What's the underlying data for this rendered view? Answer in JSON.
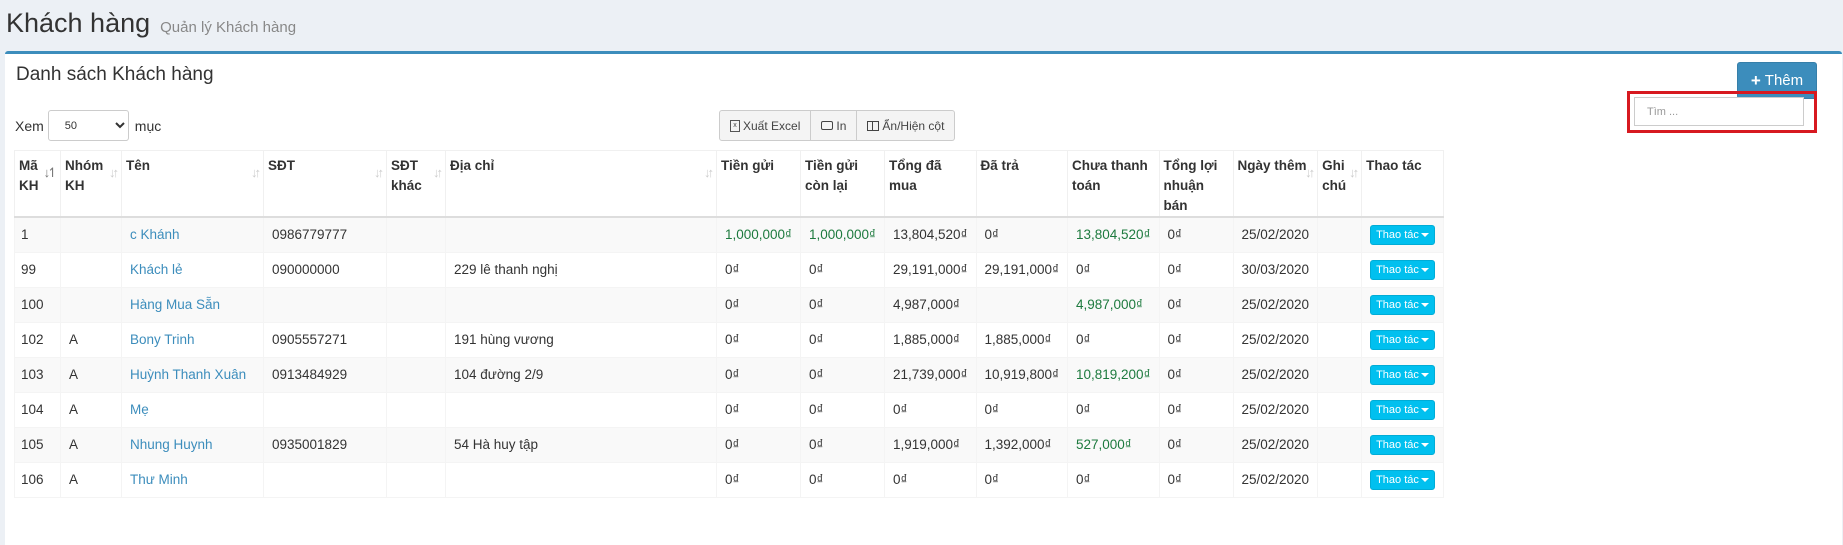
{
  "header": {
    "title": "Khách hàng",
    "subtitle": "Quản lý Khách hàng"
  },
  "box": {
    "title": "Danh sách Khách hàng",
    "add_label": "Thêm"
  },
  "length_menu": {
    "prefix": "Xem",
    "selected": "50",
    "suffix": "mục"
  },
  "toolbar": {
    "excel_label": "Xuất Excel",
    "print_label": "In",
    "columns_label": "Ẩn/Hiện cột"
  },
  "search": {
    "placeholder": "Tìm ..."
  },
  "table": {
    "columns": [
      "Mã KH",
      "Nhóm KH",
      "Tên",
      "SĐT",
      "SĐT khác",
      "Địa chỉ",
      "Tiền gửi",
      "Tiền gửi còn lại",
      "Tổng đã mua",
      "Đã trả",
      "Chưa thanh toán",
      "Tổng lợi nhuận bán",
      "Ngày thêm",
      "Ghi chú",
      "Thao tác"
    ],
    "action_label": "Thao tác",
    "rows": [
      {
        "id": "1",
        "group": "",
        "name": "c Khánh",
        "phone": "0986779777",
        "phone2": "",
        "address": "",
        "deposit": "1,000,000₫",
        "deposit_left": "1,000,000₫",
        "total": "13,804,520₫",
        "paid": "0₫",
        "unpaid": "13,804,520₫",
        "profit": "0₫",
        "date": "25/02/2020",
        "note": ""
      },
      {
        "id": "99",
        "group": "",
        "name": "Khách lẻ",
        "phone": "090000000",
        "phone2": "",
        "address": "229 lê thanh nghị",
        "deposit": "0₫",
        "deposit_left": "0₫",
        "total": "29,191,000₫",
        "paid": "29,191,000₫",
        "unpaid": "0₫",
        "profit": "0₫",
        "date": "30/03/2020",
        "note": ""
      },
      {
        "id": "100",
        "group": "",
        "name": "Hàng Mua Sẵn",
        "phone": "",
        "phone2": "",
        "address": "",
        "deposit": "0₫",
        "deposit_left": "0₫",
        "total": "4,987,000₫",
        "paid": "",
        "unpaid": "4,987,000₫",
        "profit": "0₫",
        "date": "25/02/2020",
        "note": ""
      },
      {
        "id": "102",
        "group": "A",
        "name": "Bony Trinh",
        "phone": "0905557271",
        "phone2": "",
        "address": "191 hùng vương",
        "deposit": "0₫",
        "deposit_left": "0₫",
        "total": "1,885,000₫",
        "paid": "1,885,000₫",
        "unpaid": "0₫",
        "profit": "0₫",
        "date": "25/02/2020",
        "note": ""
      },
      {
        "id": "103",
        "group": "A",
        "name": "Huỳnh Thanh Xuân",
        "phone": "0913484929",
        "phone2": "",
        "address": "104 đường 2/9",
        "deposit": "0₫",
        "deposit_left": "0₫",
        "total": "21,739,000₫",
        "paid": "10,919,800₫",
        "unpaid": "10,819,200₫",
        "profit": "0₫",
        "date": "25/02/2020",
        "note": ""
      },
      {
        "id": "104",
        "group": "A",
        "name": "Mẹ",
        "phone": "",
        "phone2": "",
        "address": "",
        "deposit": "0₫",
        "deposit_left": "0₫",
        "total": "0₫",
        "paid": "0₫",
        "unpaid": "0₫",
        "profit": "0₫",
        "date": "25/02/2020",
        "note": ""
      },
      {
        "id": "105",
        "group": "A",
        "name": "Nhung Huynh",
        "phone": "0935001829",
        "phone2": "",
        "address": "54 Hà huy tập",
        "deposit": "0₫",
        "deposit_left": "0₫",
        "total": "1,919,000₫",
        "paid": "1,392,000₫",
        "unpaid": "527,000₫",
        "profit": "0₫",
        "date": "25/02/2020",
        "note": ""
      },
      {
        "id": "106",
        "group": "A",
        "name": "Thư Minh",
        "phone": "",
        "phone2": "",
        "address": "",
        "deposit": "0₫",
        "deposit_left": "0₫",
        "total": "0₫",
        "paid": "0₫",
        "unpaid": "0₫",
        "profit": "0₫",
        "date": "25/02/2020",
        "note": ""
      }
    ]
  },
  "colors": {
    "primary": "#3c8dbc",
    "action": "#00c0ef",
    "highlight_border": "#d71920",
    "positive_amount": "#1d7a3e"
  }
}
